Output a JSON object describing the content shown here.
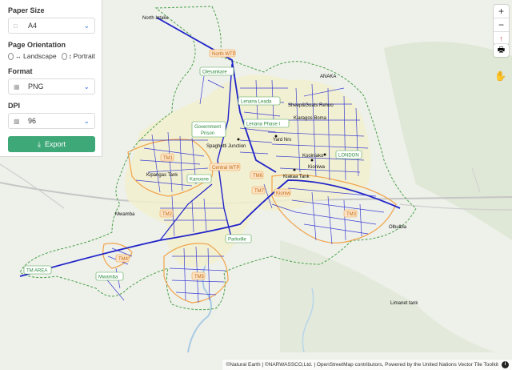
{
  "panel": {
    "paper_size": {
      "label": "Paper Size",
      "value": "A4",
      "icon": "file-icon"
    },
    "orientation": {
      "label": "Page Orientation",
      "options": [
        {
          "label": "Landscape",
          "icon": "horizontal-arrows-icon"
        },
        {
          "label": "Portrait",
          "icon": "vertical-arrows-icon"
        }
      ]
    },
    "format": {
      "label": "Format",
      "value": "PNG",
      "icon": "image-icon"
    },
    "dpi": {
      "label": "DPI",
      "value": "96",
      "icon": "chart-icon"
    },
    "export_label": "Export"
  },
  "controls": {
    "zoom_in": "+",
    "zoom_out": "−",
    "compass": "↑",
    "print": "🖶"
  },
  "attribution": {
    "text": "©Natural Earth | ©NARWASSCO,Ltd. | OpenStreetMap contributors, Powered by the United Nations Vector Tile Toolkit"
  },
  "colors": {
    "pipe": "#1f22c8",
    "boundary": "#4aa24a",
    "zone": "#f0a34a",
    "town": "#f2f0cf",
    "water": "#bcd9ef",
    "road": "#c4c4c4"
  },
  "labels": {
    "north_intake": "North Intake",
    "north_wtp": "North WTP",
    "olesankare": "Olesankare",
    "lenana_leada": "Lenana Leada",
    "anaka": "ANAKA",
    "sheep_goats": "Sheep&Goats Rehoo",
    "government_prison": [
      "Government",
      "Prison"
    ],
    "lenana_phase": "Lenana Phase I",
    "kiaragos_bold": "Kiaragos Boma",
    "yard_nrs": "Yard Nrs",
    "spaghetti_junction": "Spaghetti Junction",
    "tm1": "TM1",
    "kipangas": "Kipangas Tank",
    "central_wtp": "Central WTP",
    "kanoone": "Kanoone",
    "kiakaa_tank": "Kiakaa Tank",
    "kooiniako": "Kooiniako",
    "london": "LONDON",
    "kioniwa": "Kioniwa",
    "tm6": "TM6",
    "kioniw": "Kioniw",
    "tm2": "TM2",
    "mwamba_tank": "Mwamba",
    "tm3": "TM3",
    "mwamba": "Mwamba",
    "tm4": "TM4",
    "tm5": "TM5",
    "tm7": "TM7",
    "olbulbia": "Olbulbia",
    "tm_area": "TM AREA",
    "parkville": "Parkville",
    "limanet": "Limanet tank"
  }
}
